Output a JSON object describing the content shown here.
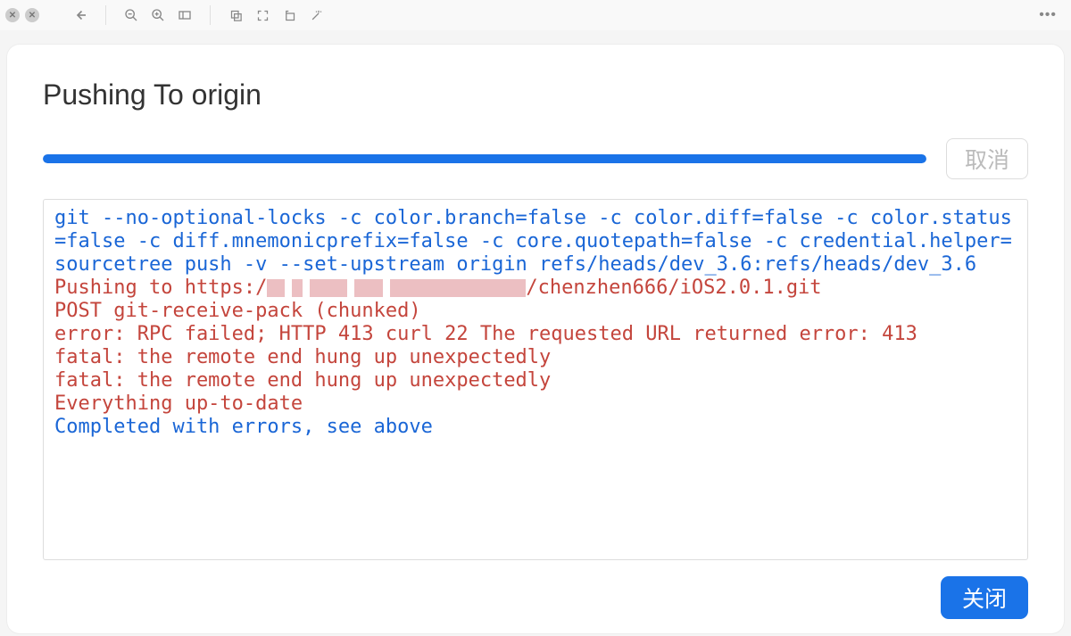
{
  "dialog": {
    "title": "Pushing To origin",
    "cancel_label": "取消",
    "close_label": "关闭",
    "progress_percent": 100
  },
  "output": {
    "command": "git --no-optional-locks -c color.branch=false -c color.diff=false -c color.status=false -c diff.mnemonicprefix=false -c core.quotepath=false -c credential.helper=sourcetree push -v --set-upstream origin refs/heads/dev_3.6:refs/heads/dev_3.6",
    "err_push_prefix": "Pushing to https:/",
    "err_push_suffix": "/chenzhen666/iOS2.0.1.git",
    "err_post": "POST git-receive-pack (chunked)",
    "err_rpc": "error: RPC failed; HTTP 413 curl 22 The requested URL returned error: 413",
    "err_fatal1": "fatal: the remote end hung up unexpectedly",
    "err_fatal2": "fatal: the remote end hung up unexpectedly",
    "err_uptodate": "Everything up-to-date",
    "completed": "Completed with errors, see above"
  }
}
